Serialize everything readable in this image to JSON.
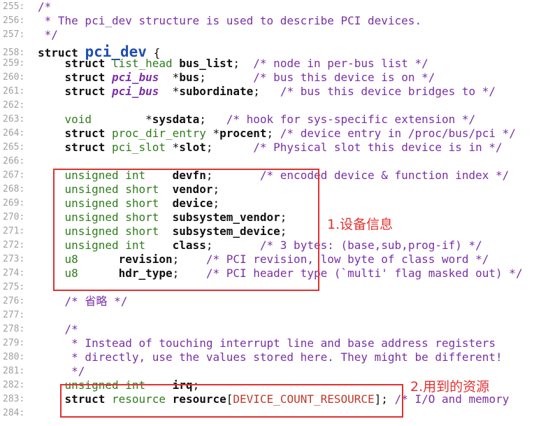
{
  "lines": [
    {
      "n": "255:",
      "segs": [
        {
          "t": "/*",
          "c": "cmt"
        }
      ]
    },
    {
      "n": "256:",
      "segs": [
        {
          "t": " * The pci_dev structure is used to describe PCI devices.",
          "c": "cmt"
        }
      ]
    },
    {
      "n": "257:",
      "segs": [
        {
          "t": " */",
          "c": "cmt"
        }
      ]
    },
    {
      "n": "258:",
      "segs": [
        {
          "t": "struct ",
          "c": "kw"
        },
        {
          "t": "pci_dev",
          "c": "fn"
        },
        {
          "t": " {",
          "c": "def"
        }
      ]
    },
    {
      "n": "259:",
      "segs": [
        {
          "t": "    struct ",
          "c": "kw"
        },
        {
          "t": "list_head",
          "c": "ty"
        },
        {
          "t": " bus_list",
          "c": "idb"
        },
        {
          "t": ";  ",
          "c": "def"
        },
        {
          "t": "/* node in per-bus list */",
          "c": "cmt"
        }
      ]
    },
    {
      "n": "260:",
      "segs": [
        {
          "t": "    struct ",
          "c": "kw"
        },
        {
          "t": "pci_bus",
          "c": "it"
        },
        {
          "t": "  *",
          "c": "def"
        },
        {
          "t": "bus",
          "c": "idb"
        },
        {
          "t": ";       ",
          "c": "def"
        },
        {
          "t": "/* bus this device is on */",
          "c": "cmt"
        }
      ]
    },
    {
      "n": "261:",
      "segs": [
        {
          "t": "    struct ",
          "c": "kw"
        },
        {
          "t": "pci_bus",
          "c": "it"
        },
        {
          "t": "  *",
          "c": "def"
        },
        {
          "t": "subordinate",
          "c": "idb"
        },
        {
          "t": ";   ",
          "c": "def"
        },
        {
          "t": "/* bus this device bridges to */",
          "c": "cmt"
        }
      ]
    },
    {
      "n": "262:",
      "segs": []
    },
    {
      "n": "263:",
      "segs": [
        {
          "t": "    void",
          "c": "ty"
        },
        {
          "t": "        *",
          "c": "def"
        },
        {
          "t": "sysdata",
          "c": "idb"
        },
        {
          "t": ";   ",
          "c": "def"
        },
        {
          "t": "/* hook for sys-specific extension */",
          "c": "cmt"
        }
      ]
    },
    {
      "n": "264:",
      "segs": [
        {
          "t": "    struct ",
          "c": "kw"
        },
        {
          "t": "proc_dir_entry",
          "c": "ty"
        },
        {
          "t": " *",
          "c": "def"
        },
        {
          "t": "procent",
          "c": "idb"
        },
        {
          "t": "; ",
          "c": "def"
        },
        {
          "t": "/* device entry in /proc/bus/pci */",
          "c": "cmt"
        }
      ]
    },
    {
      "n": "265:",
      "segs": [
        {
          "t": "    struct ",
          "c": "kw"
        },
        {
          "t": "pci_slot",
          "c": "ty"
        },
        {
          "t": " *",
          "c": "def"
        },
        {
          "t": "slot",
          "c": "idb"
        },
        {
          "t": ";      ",
          "c": "def"
        },
        {
          "t": "/* Physical slot this device is in */",
          "c": "cmt"
        }
      ]
    },
    {
      "n": "266:",
      "segs": []
    },
    {
      "n": "267:",
      "segs": [
        {
          "t": "    unsigned int",
          "c": "ty"
        },
        {
          "t": "    ",
          "c": "def"
        },
        {
          "t": "devfn",
          "c": "idb"
        },
        {
          "t": ";       ",
          "c": "def"
        },
        {
          "t": "/* encoded device & function index */",
          "c": "cmt"
        }
      ]
    },
    {
      "n": "268:",
      "segs": [
        {
          "t": "    unsigned short",
          "c": "ty"
        },
        {
          "t": "  ",
          "c": "def"
        },
        {
          "t": "vendor",
          "c": "idb"
        },
        {
          "t": ";",
          "c": "def"
        }
      ]
    },
    {
      "n": "269:",
      "segs": [
        {
          "t": "    unsigned short",
          "c": "ty"
        },
        {
          "t": "  ",
          "c": "def"
        },
        {
          "t": "device",
          "c": "idb"
        },
        {
          "t": ";",
          "c": "def"
        }
      ]
    },
    {
      "n": "270:",
      "segs": [
        {
          "t": "    unsigned short",
          "c": "ty"
        },
        {
          "t": "  ",
          "c": "def"
        },
        {
          "t": "subsystem_vendor",
          "c": "idb"
        },
        {
          "t": ";",
          "c": "def"
        }
      ]
    },
    {
      "n": "271:",
      "segs": [
        {
          "t": "    unsigned short",
          "c": "ty"
        },
        {
          "t": "  ",
          "c": "def"
        },
        {
          "t": "subsystem_device",
          "c": "idb"
        },
        {
          "t": ";",
          "c": "def"
        }
      ]
    },
    {
      "n": "272:",
      "segs": [
        {
          "t": "    unsigned int",
          "c": "ty"
        },
        {
          "t": "    ",
          "c": "def"
        },
        {
          "t": "class",
          "c": "idb"
        },
        {
          "t": ";       ",
          "c": "def"
        },
        {
          "t": "/* 3 bytes: (base,sub,prog-if) */",
          "c": "cmt"
        }
      ]
    },
    {
      "n": "273:",
      "segs": [
        {
          "t": "    u8",
          "c": "ty"
        },
        {
          "t": "      ",
          "c": "def"
        },
        {
          "t": "revision",
          "c": "idb"
        },
        {
          "t": ";    ",
          "c": "def"
        },
        {
          "t": "/* PCI revision, low byte of class word */",
          "c": "cmt"
        }
      ]
    },
    {
      "n": "274:",
      "segs": [
        {
          "t": "    u8",
          "c": "ty"
        },
        {
          "t": "      ",
          "c": "def"
        },
        {
          "t": "hdr_type",
          "c": "idb"
        },
        {
          "t": ";    ",
          "c": "def"
        },
        {
          "t": "/* PCI header type (`multi' flag masked out) */",
          "c": "cmt"
        }
      ]
    },
    {
      "n": "275:",
      "segs": []
    },
    {
      "n": "276:",
      "segs": [
        {
          "t": "    /* 省略 */",
          "c": "cmt"
        }
      ]
    },
    {
      "n": "277:",
      "segs": []
    },
    {
      "n": "278:",
      "segs": [
        {
          "t": "    /*",
          "c": "cmt"
        }
      ]
    },
    {
      "n": "279:",
      "segs": [
        {
          "t": "     * Instead of touching interrupt line and base address registers",
          "c": "cmt"
        }
      ]
    },
    {
      "n": "280:",
      "segs": [
        {
          "t": "     * directly, use the values stored here. They might be different!",
          "c": "cmt"
        }
      ]
    },
    {
      "n": "281:",
      "segs": [
        {
          "t": "     */",
          "c": "cmt"
        }
      ]
    },
    {
      "n": "282:",
      "segs": [
        {
          "t": "    unsigned int",
          "c": "ty"
        },
        {
          "t": "    ",
          "c": "def"
        },
        {
          "t": "irq",
          "c": "idb"
        },
        {
          "t": ";",
          "c": "def"
        }
      ]
    },
    {
      "n": "283:",
      "segs": [
        {
          "t": "    struct ",
          "c": "kw"
        },
        {
          "t": "resource",
          "c": "ty"
        },
        {
          "t": " ",
          "c": "def"
        },
        {
          "t": "resource",
          "c": "idb"
        },
        {
          "t": "[",
          "c": "def"
        },
        {
          "t": "DEVICE_COUNT_RESOURCE",
          "c": "mac"
        },
        {
          "t": "]; ",
          "c": "def"
        },
        {
          "t": "/* I/O and memory",
          "c": "cmt"
        }
      ]
    },
    {
      "n": "284:",
      "segs": []
    }
  ],
  "annotations": [
    {
      "label": "1.设备信息"
    },
    {
      "label": "2.用到的资源"
    }
  ],
  "colors": {
    "comment": "#7a2fa6",
    "type": "#2e7d1a",
    "identifier": "#111111",
    "struct_name": "#1f4fb0",
    "macro": "#c0392b",
    "annotation": "#e53030",
    "line_number": "#a0a0a0"
  }
}
